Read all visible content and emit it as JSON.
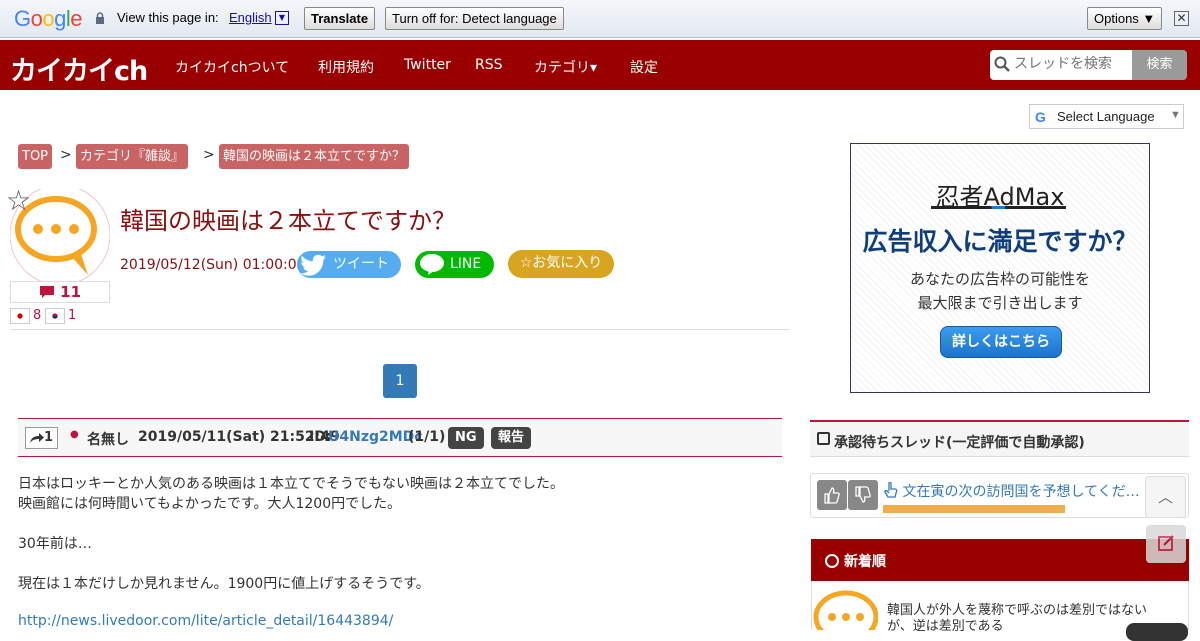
{
  "translate_bar": {
    "google_logo": "Google",
    "view_text": "View this page in:",
    "language": "English",
    "translate_label": "Translate",
    "turn_off_label": "Turn off for: Detect language",
    "options_label": "Options ▼",
    "close_symbol": "✕"
  },
  "header": {
    "logo": "カイカイch",
    "nav": [
      "カイカイchついて",
      "利用規約",
      "Twitter",
      "RSS",
      "カテゴリ▾",
      "設定"
    ],
    "search_placeholder": "スレッドを検索",
    "search_button": "検索"
  },
  "select_language": {
    "g": "G",
    "label": "Select Language",
    "arrow": "▼"
  },
  "breadcrumb": {
    "items": [
      "TOP",
      "カテゴリ『雑談』",
      "韓国の映画は２本立てですか？"
    ],
    "separator": ">"
  },
  "thread": {
    "title": "韓国の映画は２本立てですか？",
    "date": "2019/05/12(Sun) 01:00:02",
    "comment_count": "11",
    "flag_counts": [
      "8",
      "1"
    ],
    "tweet_label": "ツイート",
    "line_label": "LINE",
    "favorite_label": "☆お気に入り",
    "star": "☆"
  },
  "pagination": {
    "current": "1"
  },
  "post": {
    "number": "1",
    "name": "名無し",
    "date": "2019/05/11(Sat) 21:52:49",
    "id_label": "ID:",
    "id": "U4Nzg2MDc",
    "id_count": "(1/1)",
    "ng_label": "NG",
    "report_label": "報告",
    "body_lines": [
      "日本はロッキーとか人気のある映画は１本立てでそうでもない映画は２本立てでした。",
      "映画館には何時間いてもよかったです。大人1200円でした。",
      "30年前は…",
      "現在は１本だけしか見れません。1900円に値上げするそうです。"
    ],
    "link": "http://news.livedoor.com/lite/article_detail/16443894/"
  },
  "ad": {
    "brand": "忍者AdMax",
    "headline": "広告収入に満足ですか？",
    "sub1": "あなたの広告枠の可能性を",
    "sub2": "最大限まで引き出します",
    "button": "詳しくはこちら"
  },
  "sidebar": {
    "approval_title": "承認待ちスレッド(一定評価で自動承認)",
    "approval_item": "文在寅の次の訪問国を予想してくだ…",
    "approval_progress_fraction": 0.5,
    "new_title": "新着順",
    "new_item_line1": "韓国人が外人を蔑称で呼ぶのは差別ではない",
    "new_item_line2": "が、逆は差別である",
    "scroll_top_symbol": "︿"
  },
  "colors": {
    "header": "#990000",
    "accent": "#c0143c",
    "link": "#337ab7",
    "twitter": "#55acee",
    "line": "#00b900",
    "favorite": "#d9a521"
  }
}
